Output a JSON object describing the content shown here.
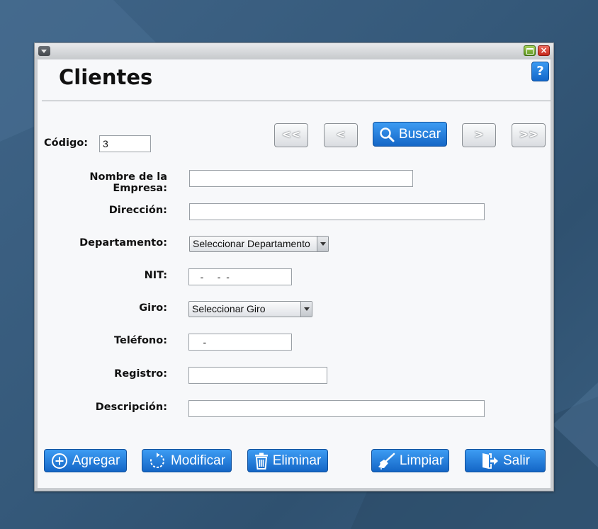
{
  "window": {
    "title": "Clientes",
    "help_label": "?",
    "close_label": "×"
  },
  "fields": {
    "codigo_label": "Código:",
    "codigo_value": "3",
    "empresa_label": "Nombre de la Empresa:",
    "empresa_value": "",
    "direccion_label": "Dirección:",
    "direccion_value": "",
    "departamento_label": "Departamento:",
    "departamento_selected": "Seleccionar Departamento",
    "nit_label": "NIT:",
    "nit_value": "   -     -  -",
    "giro_label": "Giro:",
    "giro_selected": "Seleccionar Giro",
    "telefono_label": "Teléfono:",
    "telefono_value": "    -",
    "registro_label": "Registro:",
    "registro_value": "",
    "descripcion_label": "Descripción:",
    "descripcion_value": ""
  },
  "nav": {
    "first_label": "<<",
    "prev_label": "<",
    "search_label": "Buscar",
    "next_label": ">",
    "last_label": ">>"
  },
  "actions": {
    "add_label": "Agregar",
    "modify_label": "Modificar",
    "delete_label": "Eliminar",
    "clear_label": "Limpiar",
    "exit_label": "Salir"
  },
  "colors": {
    "accent_blue": "#1f7ddc",
    "maximize_green": "#7ab33a",
    "close_red": "#d6382b"
  }
}
